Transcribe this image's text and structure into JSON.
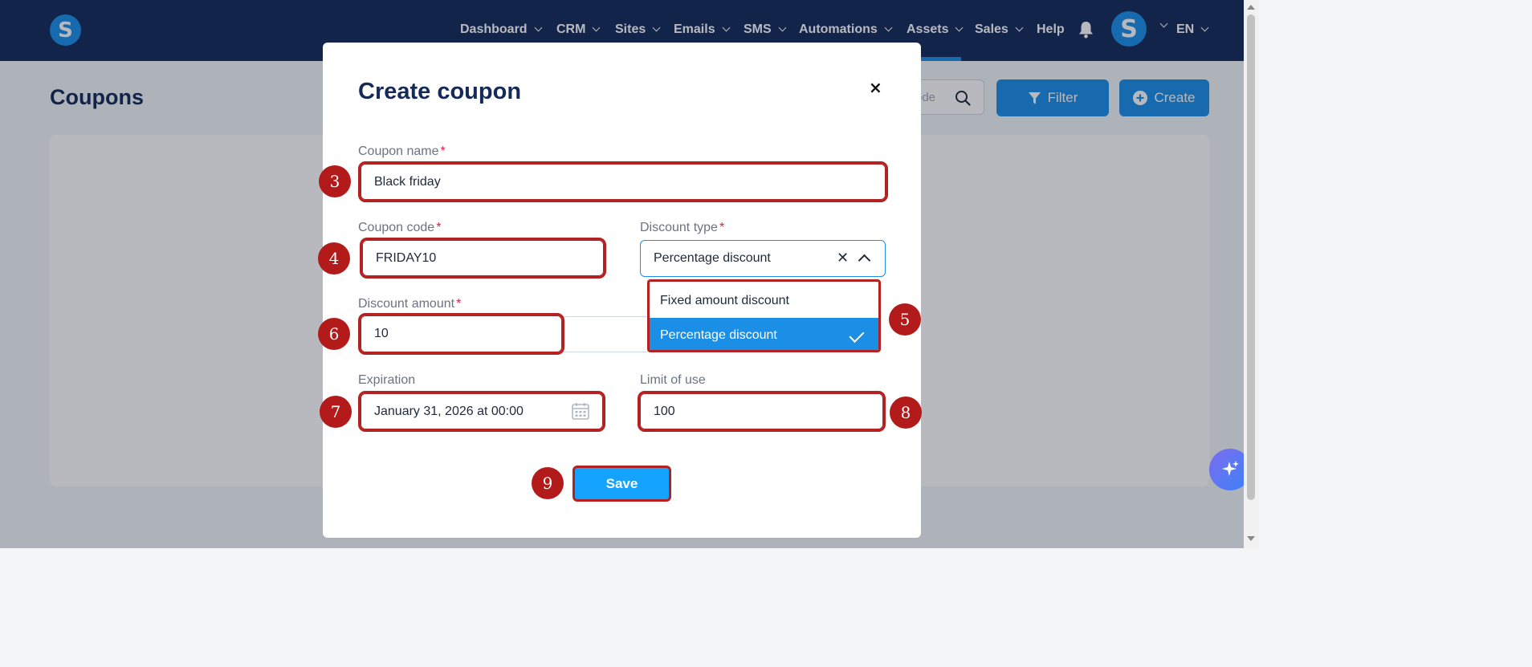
{
  "nav": {
    "logo": "S",
    "items": [
      "Dashboard",
      "CRM",
      "Sites",
      "Emails",
      "SMS",
      "Automations",
      "Assets",
      "Sales",
      "Help"
    ],
    "avatar": "S",
    "language": "EN"
  },
  "page": {
    "title": "Coupons",
    "search_placeholder": "ode",
    "filter_label": "Filter",
    "create_label": "Create"
  },
  "modal": {
    "title": "Create coupon",
    "close": "×",
    "fields": {
      "coupon_name": {
        "label": "Coupon name",
        "value": "Black friday"
      },
      "coupon_code": {
        "label": "Coupon code",
        "value": "FRIDAY10"
      },
      "discount_type": {
        "label": "Discount type",
        "value": "Percentage discount"
      },
      "discount_amount": {
        "label": "Discount amount",
        "value": "10"
      },
      "expiration": {
        "label": "Expiration",
        "value": "January 31, 2026 at 00:00"
      },
      "limit_of_use": {
        "label": "Limit of use",
        "value": "100"
      }
    },
    "required_marker": "*",
    "discount_type_options": [
      "Fixed amount discount",
      "Percentage discount"
    ],
    "save_label": "Save"
  },
  "annotations": [
    "3",
    "4",
    "5",
    "6",
    "7",
    "8",
    "9"
  ],
  "colors": {
    "nav_bg": "#152a58",
    "accent": "#1b8fe6",
    "highlight": "#b22222",
    "save_button": "#14a4ff"
  }
}
